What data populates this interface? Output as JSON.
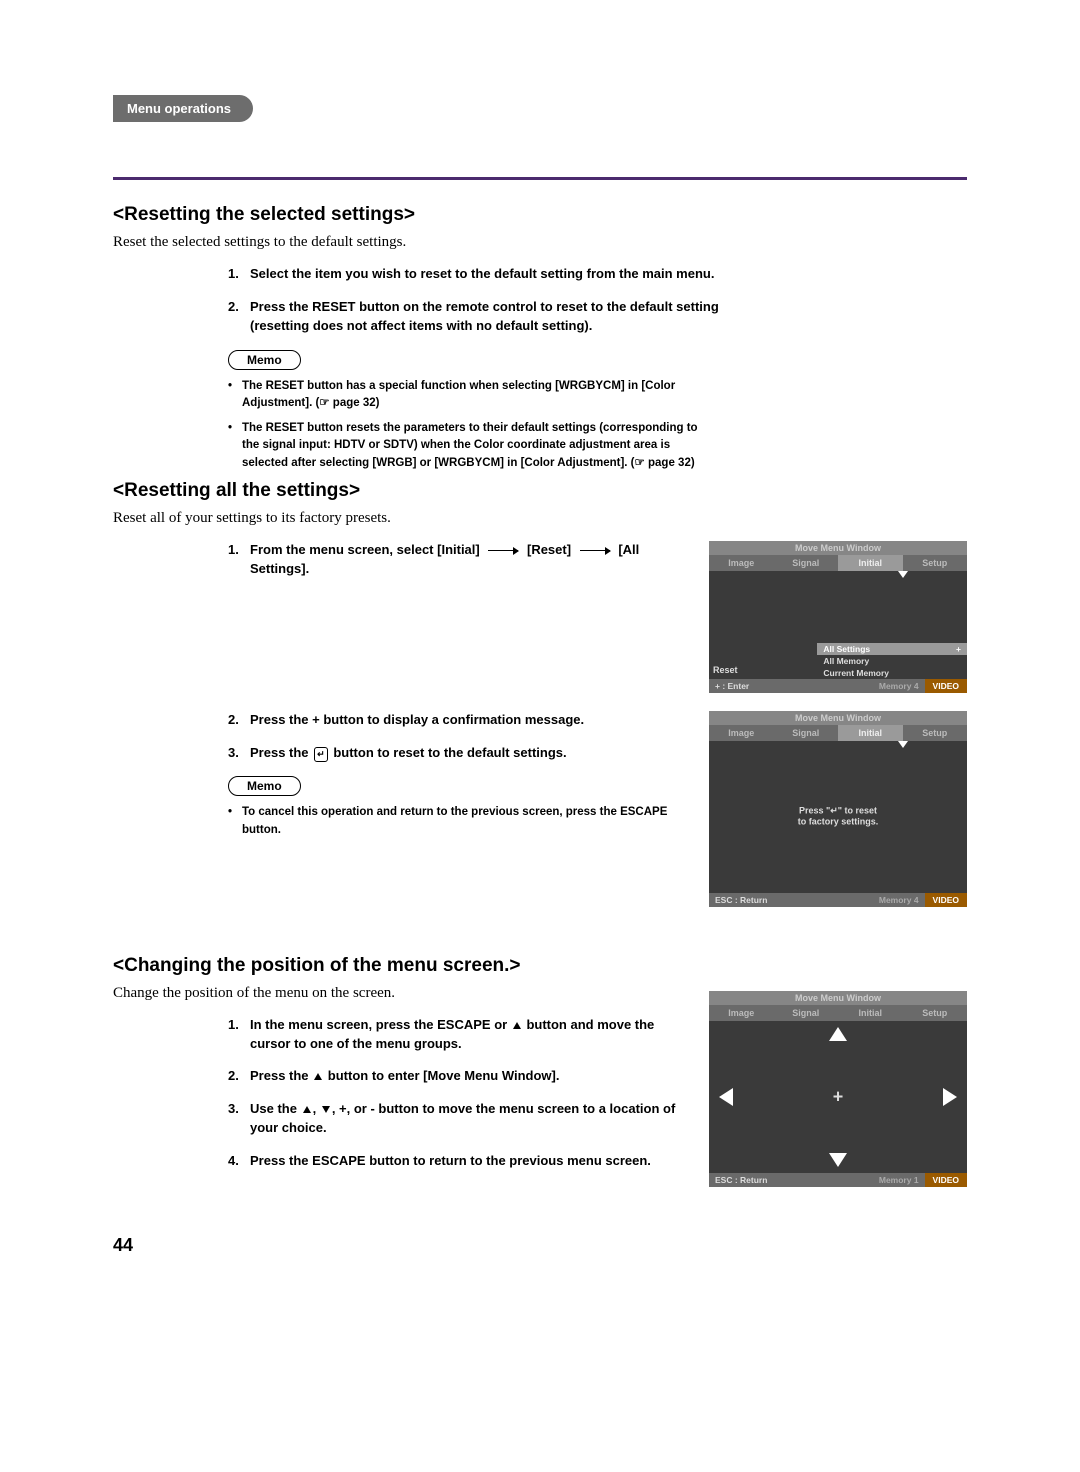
{
  "tab_label": "Menu operations",
  "page_number": "44",
  "sec1": {
    "title": "<Resetting the selected settings>",
    "intro": "Reset the selected settings to the default settings.",
    "steps": [
      "Select the item you wish to reset to the default setting from the main menu.",
      "Press the RESET button on the remote control to reset to the default setting (resetting does not affect items with no default setting)."
    ],
    "memo_label": "Memo",
    "memo": [
      "The RESET button has a special function when selecting [WRGBYCM] in [Color Adjustment]. (☞ page 32)",
      "The RESET button resets the parameters to their default settings (corresponding to the signal input: HDTV or SDTV) when the Color coordinate adjustment area is selected after selecting  [WRGB] or [WRGBYCM] in [Color Adjustment]. (☞ page 32)"
    ]
  },
  "sec2": {
    "title": "<Resetting all the settings>",
    "intro": "Reset all of your settings to its factory presets.",
    "step1_pre": "From the menu screen, select [Initial]",
    "step1_mid": "[Reset]",
    "step1_end": "[All Settings].",
    "step2": "Press the + button to display a confirmation message.",
    "step3_pre": "Press the",
    "step3_post": "button to reset to the default settings.",
    "memo_label": "Memo",
    "memo": [
      "To cancel this operation and return to the previous screen, press the ESCAPE button."
    ]
  },
  "sec3": {
    "title": "<Changing the position of the menu screen.>",
    "intro": "Change the position of the menu on the screen.",
    "step1_pre": "In the menu screen, press the ESCAPE or",
    "step1_post": "button and move the cursor to one of the menu groups.",
    "step2_pre": "Press the",
    "step2_post": "button to enter [Move Menu Window].",
    "step3_pre": "Use the",
    "step3_post": ", +, or - button to move the menu screen to a location of your choice.",
    "step4": "Press the ESCAPE button to return to the previous menu screen."
  },
  "osd": {
    "title": "Move Menu Window",
    "tabs": [
      "Image",
      "Signal",
      "Initial",
      "Setup"
    ],
    "opts": [
      "All Settings",
      "All Memory",
      "Current Memory"
    ],
    "side_label": "Reset",
    "hint_line1": "Press \"↵\" to reset",
    "hint_line2": "to factory settings.",
    "foot_enter": "+ : Enter",
    "foot_esc": "ESC : Return",
    "foot_mem1": "Memory 1",
    "foot_mem4": "Memory 4",
    "foot_video": "VIDEO"
  }
}
